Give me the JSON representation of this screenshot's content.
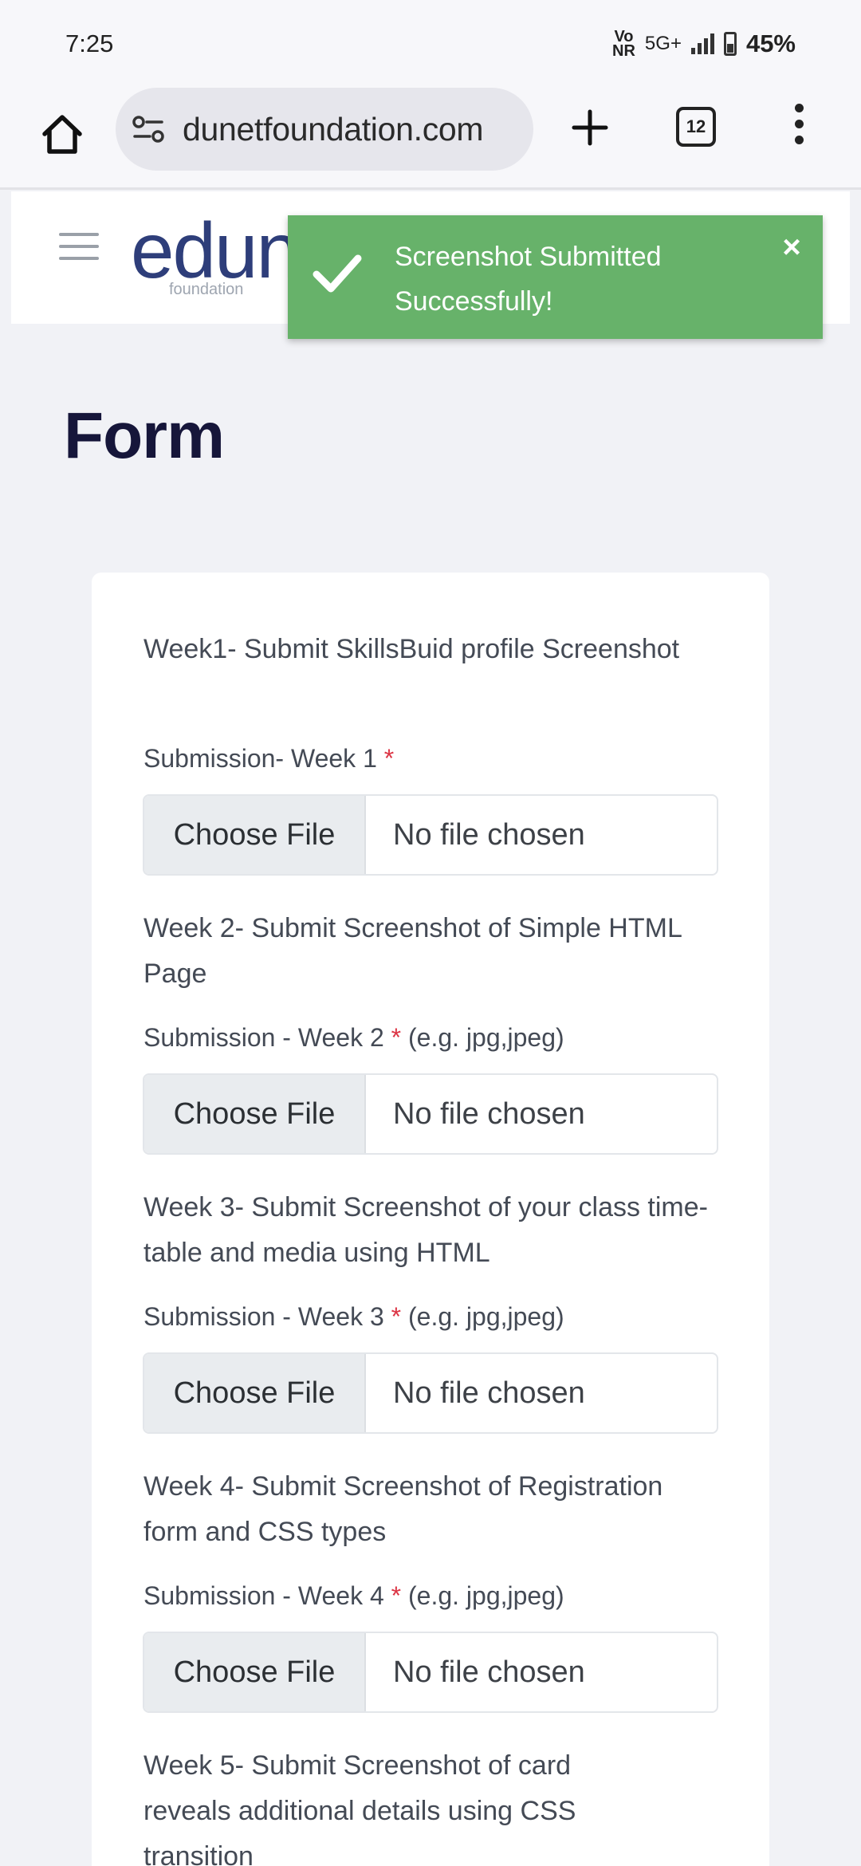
{
  "status_bar": {
    "time": "7:25",
    "volte_top": "Vo",
    "volte_bottom": "NR",
    "network": "5G+",
    "battery": "45%"
  },
  "browser": {
    "url": "dunetfoundation.com",
    "tab_count": "12"
  },
  "site": {
    "logo_text": "edunet",
    "logo_sub": "foundation"
  },
  "toast": {
    "line1": "Screenshot Submitted",
    "line2": "Successfully!",
    "close": "×",
    "color": "#67b26a"
  },
  "page": {
    "title": "Form"
  },
  "form": {
    "questions": [
      {
        "description": "Week1- Submit SkillsBuid profile Screenshot",
        "label": "Submission- Week 1",
        "required": "*",
        "hint": "",
        "button": "Choose File",
        "status": "No file chosen"
      },
      {
        "description": "Week 2- Submit Screenshot of Simple HTML Page",
        "label": "Submission - Week 2",
        "required": "*",
        "hint": "(e.g. jpg,jpeg)",
        "button": "Choose File",
        "status": "No file chosen"
      },
      {
        "description": "Week 3- Submit Screenshot of your class time-table and media using HTML",
        "label": "Submission - Week 3",
        "required": "*",
        "hint": "(e.g. jpg,jpeg)",
        "button": "Choose File",
        "status": "No file chosen"
      },
      {
        "description": "Week 4- Submit Screenshot of Registration form and CSS types",
        "label": "Submission - Week 4",
        "required": "*",
        "hint": "(e.g. jpg,jpeg)",
        "button": "Choose File",
        "status": "No file chosen"
      },
      {
        "description": "Week 5- Submit Screenshot of card reveals additional details using CSS transition"
      }
    ]
  }
}
